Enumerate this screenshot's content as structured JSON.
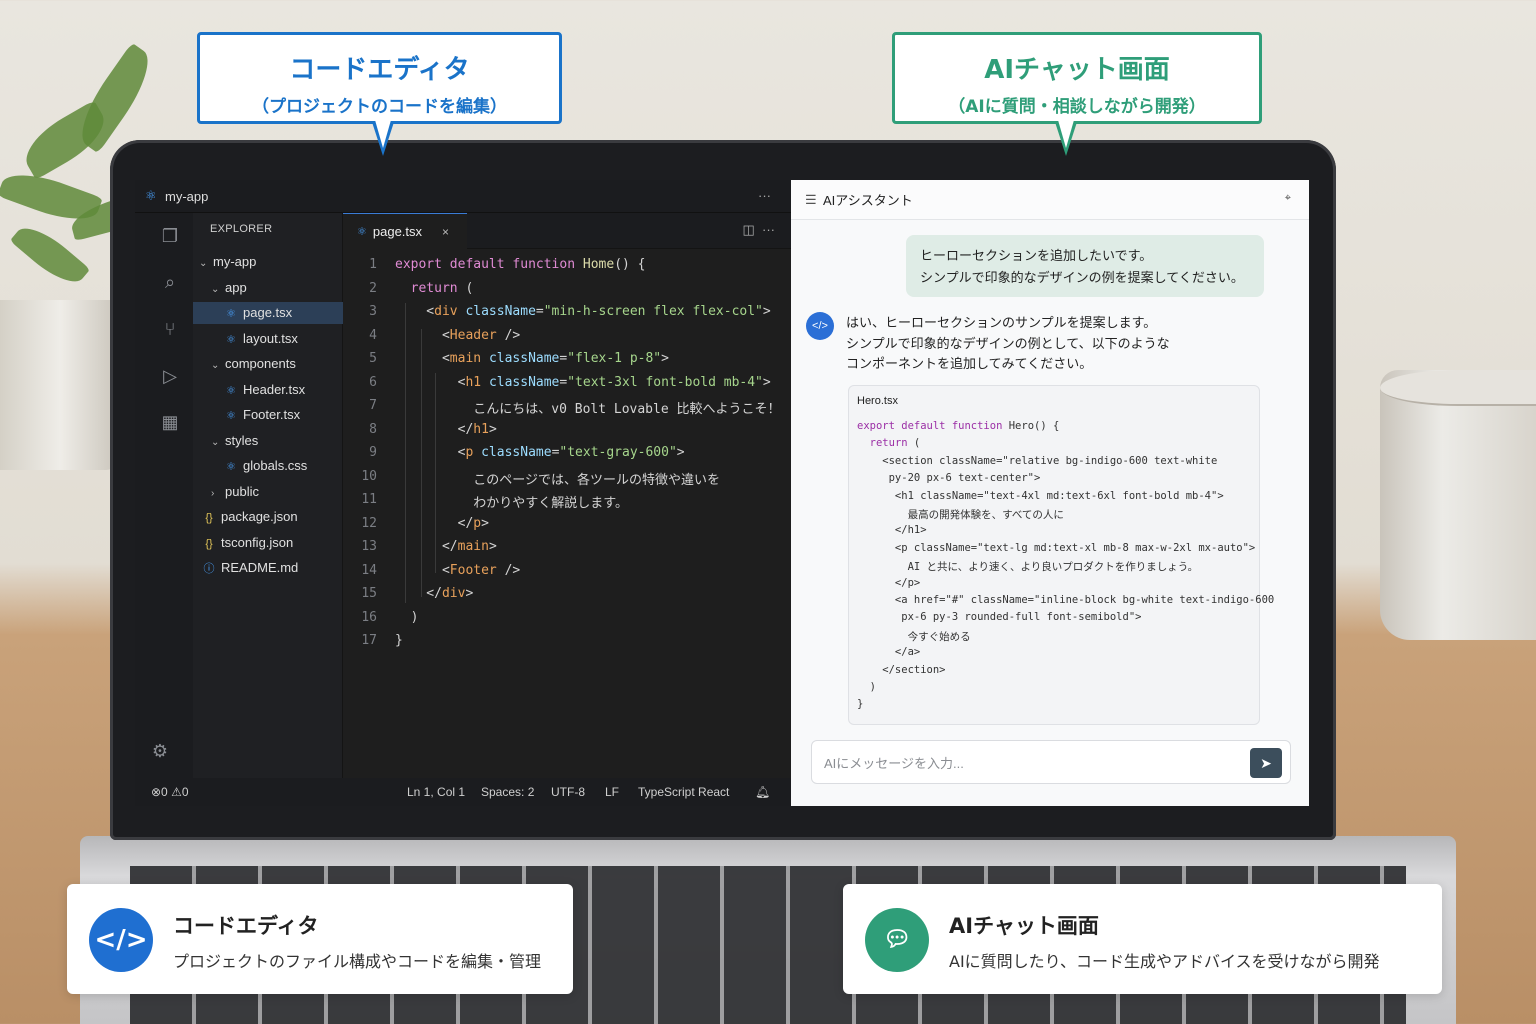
{
  "callouts": {
    "editor": {
      "title": "コードエディタ",
      "subtitle": "（プロジェクトのコードを編集）",
      "color": "#1a73c9"
    },
    "chat": {
      "title": "AIチャット画面",
      "subtitle": "（AIに質問・相談しながら開発）",
      "color": "#2f9e79"
    }
  },
  "editor": {
    "window_title": "my-app",
    "explorer_header": "EXPLORER",
    "tree": [
      {
        "label": "my-app",
        "type": "folder-open"
      },
      {
        "label": "app",
        "type": "folder-open"
      },
      {
        "label": "page.tsx",
        "type": "react",
        "selected": true
      },
      {
        "label": "layout.tsx",
        "type": "react"
      },
      {
        "label": "components",
        "type": "folder-open"
      },
      {
        "label": "Header.tsx",
        "type": "react"
      },
      {
        "label": "Footer.tsx",
        "type": "react"
      },
      {
        "label": "styles",
        "type": "folder-open"
      },
      {
        "label": "globals.css",
        "type": "css"
      },
      {
        "label": "public",
        "type": "folder-closed"
      },
      {
        "label": "package.json",
        "type": "json"
      },
      {
        "label": "tsconfig.json",
        "type": "json"
      },
      {
        "label": "README.md",
        "type": "info"
      }
    ],
    "tab": {
      "label": "page.tsx",
      "close": "×"
    },
    "code_lines": [
      "export default function Home() {",
      "  return (",
      "    <div className=\"min-h-screen flex flex-col\">",
      "      <Header />",
      "      <main className=\"flex-1 p-8\">",
      "        <h1 className=\"text-3xl font-bold mb-4\">",
      "          こんにちは、v0 Bolt Lovable 比較へようこそ！",
      "        </h1>",
      "        <p className=\"text-gray-600\">",
      "          このページでは、各ツールの特徴や違いを",
      "          わかりやすく解説します。",
      "        </p>",
      "      </main>",
      "      <Footer />",
      "    </div>",
      "  )",
      "}"
    ],
    "line_numbers": [
      "1",
      "2",
      "3",
      "4",
      "5",
      "6",
      "7",
      "8",
      "9",
      "10",
      "11",
      "12",
      "13",
      "14",
      "15",
      "16",
      "17"
    ],
    "status": {
      "problems": "⊗0 ⚠0",
      "position": "Ln 1, Col 1",
      "spaces": "Spaces: 2",
      "encoding": "UTF-8",
      "eol": "LF",
      "language": "TypeScript React"
    }
  },
  "chat": {
    "title": "AIアシスタント",
    "user_message": [
      "ヒーローセクションを追加したいです。",
      "シンプルで印象的なデザインの例を提案してください。"
    ],
    "ai_message": [
      "はい、ヒーローセクションのサンプルを提案します。",
      "シンプルで印象的なデザインの例として、以下のような",
      "コンポーネントを追加してみてください。"
    ],
    "code_file": "Hero.tsx",
    "code_lines": [
      "export default function Hero() {",
      "  return (",
      "    <section className=\"relative bg-indigo-600 text-white",
      "     py-20 px-6 text-center\">",
      "      <h1 className=\"text-4xl md:text-6xl font-bold mb-4\">",
      "        最高の開発体験を、すべての人に",
      "      </h1>",
      "      <p className=\"text-lg md:text-xl mb-8 max-w-2xl mx-auto\">",
      "        AI と共に、より速く、より良いプロダクトを作りましょう。",
      "      </p>",
      "      <a href=\"#\" className=\"inline-block bg-white text-indigo-600",
      "       px-6 py-3 rounded-full font-semibold\">",
      "        今すぐ始める",
      "      </a>",
      "    </section>",
      "  )",
      "}"
    ],
    "input_placeholder": "AIにメッセージを入力..."
  },
  "cards": {
    "editor": {
      "title": "コードエディタ",
      "desc": "プロジェクトのファイル構成やコードを編集・管理",
      "icon": "code-icon",
      "color": "#1f6fd1"
    },
    "chat": {
      "title": "AIチャット画面",
      "desc": "AIに質問したり、コード生成やアドバイスを受けながら開発",
      "icon": "chat-bubble-icon",
      "color": "#2f9e79"
    }
  }
}
